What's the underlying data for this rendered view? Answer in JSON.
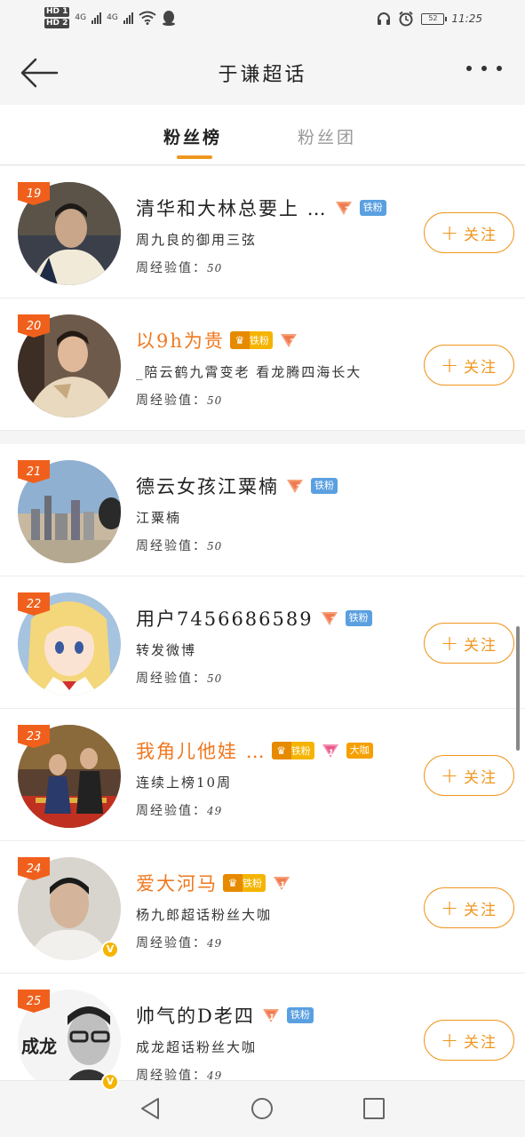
{
  "status_bar": {
    "hd1": "HD 1",
    "hd2": "HD 2",
    "net1": "4G",
    "net2": "4G",
    "battery": "52",
    "time": "11:25"
  },
  "header": {
    "title": "于谦超话"
  },
  "tabs": [
    {
      "label": "粉丝榜",
      "active": true
    },
    {
      "label": "粉丝团",
      "active": false
    }
  ],
  "exp_label": "周经验值：",
  "follow_label": "关注",
  "badges": {
    "iron_fan": "铁粉",
    "big_shot": "大咖"
  },
  "rows": [
    {
      "rank": "19",
      "name": "清华和大林总要上 …",
      "sub": "周九良的御用三弦",
      "exp": "50",
      "level": "7",
      "crown": false,
      "big": false,
      "verified": false,
      "orange": false,
      "follow": true
    },
    {
      "rank": "20",
      "name": "以9h为贵",
      "sub": "_陪云鹤九霄变老  看龙腾四海长大",
      "exp": "50",
      "level": "7",
      "crown": true,
      "big": false,
      "verified": false,
      "orange": true,
      "follow": true
    },
    {
      "rank": "21",
      "name": "德云女孩江粟楠",
      "sub": "江粟楠",
      "exp": "50",
      "level": "7",
      "crown": false,
      "big": false,
      "verified": false,
      "orange": false,
      "follow": false
    },
    {
      "rank": "22",
      "name": "用户7456686589",
      "sub": "转发微博",
      "exp": "50",
      "level": "7",
      "crown": false,
      "big": false,
      "verified": false,
      "orange": false,
      "follow": true
    },
    {
      "rank": "23",
      "name": "我角儿他娃 …",
      "sub": "连续上榜10周",
      "exp": "49",
      "level": "12",
      "crown": true,
      "big": true,
      "verified": false,
      "orange": true,
      "follow": true
    },
    {
      "rank": "24",
      "name": "爱大河马",
      "sub": "杨九郎超话粉丝大咖",
      "exp": "49",
      "level": "11",
      "crown": true,
      "big": false,
      "verified": true,
      "orange": true,
      "follow": true
    },
    {
      "rank": "25",
      "name": "帅气的D老四",
      "sub": "成龙超话粉丝大咖",
      "exp": "49",
      "level": "11",
      "crown": false,
      "big": false,
      "verified": true,
      "orange": false,
      "follow": true
    }
  ],
  "avatar_texts": {
    "row25": "成龙"
  },
  "colors": {
    "accent": "#f0961e",
    "rank_badge": "#f0601c",
    "iron_fan": "#5aa0e0",
    "orange_name": "#f0781e"
  },
  "icons": [
    "back-arrow-icon",
    "more-icon",
    "headphone-icon",
    "alarm-icon",
    "battery-icon",
    "wifi-icon",
    "qq-icon",
    "level-heart-icon",
    "crown-icon",
    "verified-icon",
    "plus-icon",
    "nav-back-icon",
    "nav-home-icon",
    "nav-recents-icon"
  ]
}
